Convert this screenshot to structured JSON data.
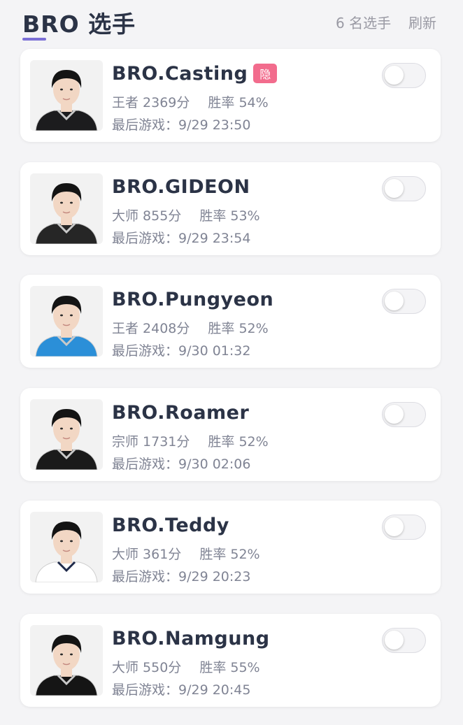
{
  "header": {
    "title": "BRO 选手",
    "count": "6 名选手",
    "refresh": "刷新"
  },
  "colors": {
    "accent": "#7b6fd6",
    "hidden_badge": "#f26c8d",
    "text_primary": "#2b3346",
    "text_secondary": "#808494"
  },
  "players": [
    {
      "name": "BRO.Casting",
      "hidden_badge": "隐",
      "rank": "王者 2369分",
      "winrate": "胜率 54%",
      "last_game": "最后游戏：9/29 23:50",
      "toggle_on": false,
      "jersey": "#1c1c1e"
    },
    {
      "name": "BRO.GIDEON",
      "hidden_badge": null,
      "rank": "大师 855分",
      "winrate": "胜率 53%",
      "last_game": "最后游戏：9/29 23:54",
      "toggle_on": false,
      "jersey": "#262626"
    },
    {
      "name": "BRO.Pungyeon",
      "hidden_badge": null,
      "rank": "王者 2408分",
      "winrate": "胜率 52%",
      "last_game": "最后游戏：9/30 01:32",
      "toggle_on": false,
      "jersey": "#2b8fd8"
    },
    {
      "name": "BRO.Roamer",
      "hidden_badge": null,
      "rank": "宗师 1731分",
      "winrate": "胜率 52%",
      "last_game": "最后游戏：9/30 02:06",
      "toggle_on": false,
      "jersey": "#1a1a1a"
    },
    {
      "name": "BRO.Teddy",
      "hidden_badge": null,
      "rank": "大师 361分",
      "winrate": "胜率 52%",
      "last_game": "最后游戏：9/29 20:23",
      "toggle_on": false,
      "jersey": "#ffffff"
    },
    {
      "name": "BRO.Namgung",
      "hidden_badge": null,
      "rank": "大师 550分",
      "winrate": "胜率 55%",
      "last_game": "最后游戏：9/29 20:45",
      "toggle_on": false,
      "jersey": "#151515"
    }
  ]
}
